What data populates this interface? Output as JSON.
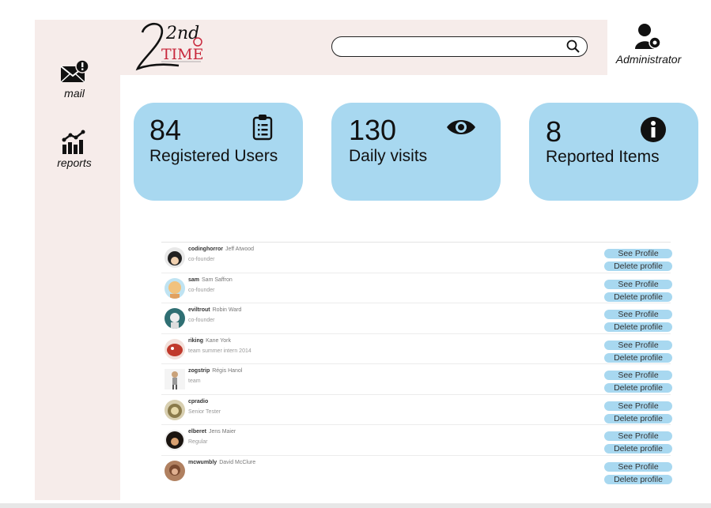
{
  "app": {
    "logo_text_top": "2nd",
    "logo_text_bottom": "TIME"
  },
  "sidebar": {
    "items": [
      {
        "label": "mail",
        "icon": "mail-alert-icon"
      },
      {
        "label": "reports",
        "icon": "bar-chart-icon"
      }
    ]
  },
  "search": {
    "placeholder": "",
    "value": "",
    "icon": "search-icon"
  },
  "admin": {
    "label": "Administrator",
    "icon": "user-gear-icon"
  },
  "stats": [
    {
      "value": "84",
      "label": "Registered Users",
      "icon": "clipboard-icon"
    },
    {
      "value": "130",
      "label": "Daily visits",
      "icon": "eye-icon"
    },
    {
      "value": "8",
      "label": "Reported Items",
      "icon": "info-icon"
    }
  ],
  "users": [
    {
      "username": "codinghorror",
      "realname": "Jeff Atwood",
      "role": "co-founder",
      "see": "See Profile",
      "delete": "Delete profile",
      "avatar_color": "#222222"
    },
    {
      "username": "sam",
      "realname": "Sam Saffron",
      "role": "co-founder",
      "see": "See Profile",
      "delete": "Delete profile",
      "avatar_color": "#f1c27d"
    },
    {
      "username": "eviltrout",
      "realname": "Robin Ward",
      "role": "co-founder",
      "see": "See Profile",
      "delete": "Delete profile",
      "avatar_color": "#2f6f73"
    },
    {
      "username": "riking",
      "realname": "Kane York",
      "role": "team summer intern 2014",
      "see": "See Profile",
      "delete": "Delete profile",
      "avatar_color": "#c0392b"
    },
    {
      "username": "zogstrip",
      "realname": "Régis Hanol",
      "role": "team",
      "see": "See Profile",
      "delete": "Delete profile",
      "avatar_color": "#dddddd"
    },
    {
      "username": "cpradio",
      "realname": "",
      "role": "Senior Tester",
      "see": "See Profile",
      "delete": "Delete profile",
      "avatar_color": "#8a7a4a"
    },
    {
      "username": "elberet",
      "realname": "Jens Maier",
      "role": "Regular",
      "see": "See Profile",
      "delete": "Delete profile",
      "avatar_color": "#3a2a1a"
    },
    {
      "username": "mcwumbly",
      "realname": "David McClure",
      "role": "",
      "see": "See Profile",
      "delete": "Delete profile",
      "avatar_color": "#7a4a30"
    }
  ],
  "colors": {
    "panel": "#f6ecea",
    "accent": "#a8d8f0",
    "logo_red": "#c8283c"
  }
}
